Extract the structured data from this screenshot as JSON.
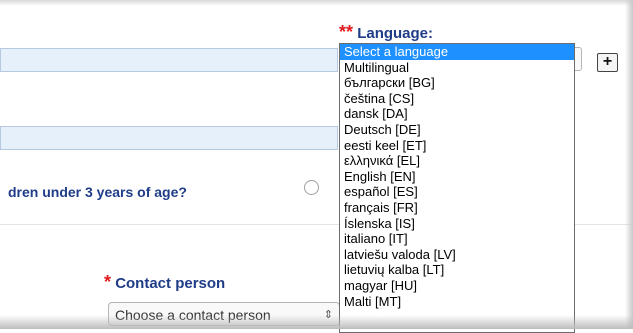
{
  "language": {
    "label": "Language:",
    "required_marker": "**",
    "add_button": "+",
    "options": [
      "Select a language",
      "Multilingual",
      "български [BG]",
      "čeština [CS]",
      "dansk [DA]",
      "Deutsch [DE]",
      "eesti keel [ET]",
      "ελληνικά [EL]",
      "English [EN]",
      "español [ES]",
      "français [FR]",
      "Íslenska [IS]",
      "italiano [IT]",
      "latviešu valoda [LV]",
      "lietuvių kalba [LT]",
      "magyar [HU]",
      "Malti [MT]"
    ],
    "selected_option": "Select a language"
  },
  "question": {
    "text": "dren under 3 years of age?"
  },
  "contact_person": {
    "required_marker": "*",
    "label": "Contact person",
    "placeholder": "Choose a contact person"
  },
  "colors": {
    "label_blue": "#1f3c88",
    "required_red": "#e0191c",
    "selected_bg": "#1e90ff",
    "input_bg": "#e6f0fb"
  }
}
